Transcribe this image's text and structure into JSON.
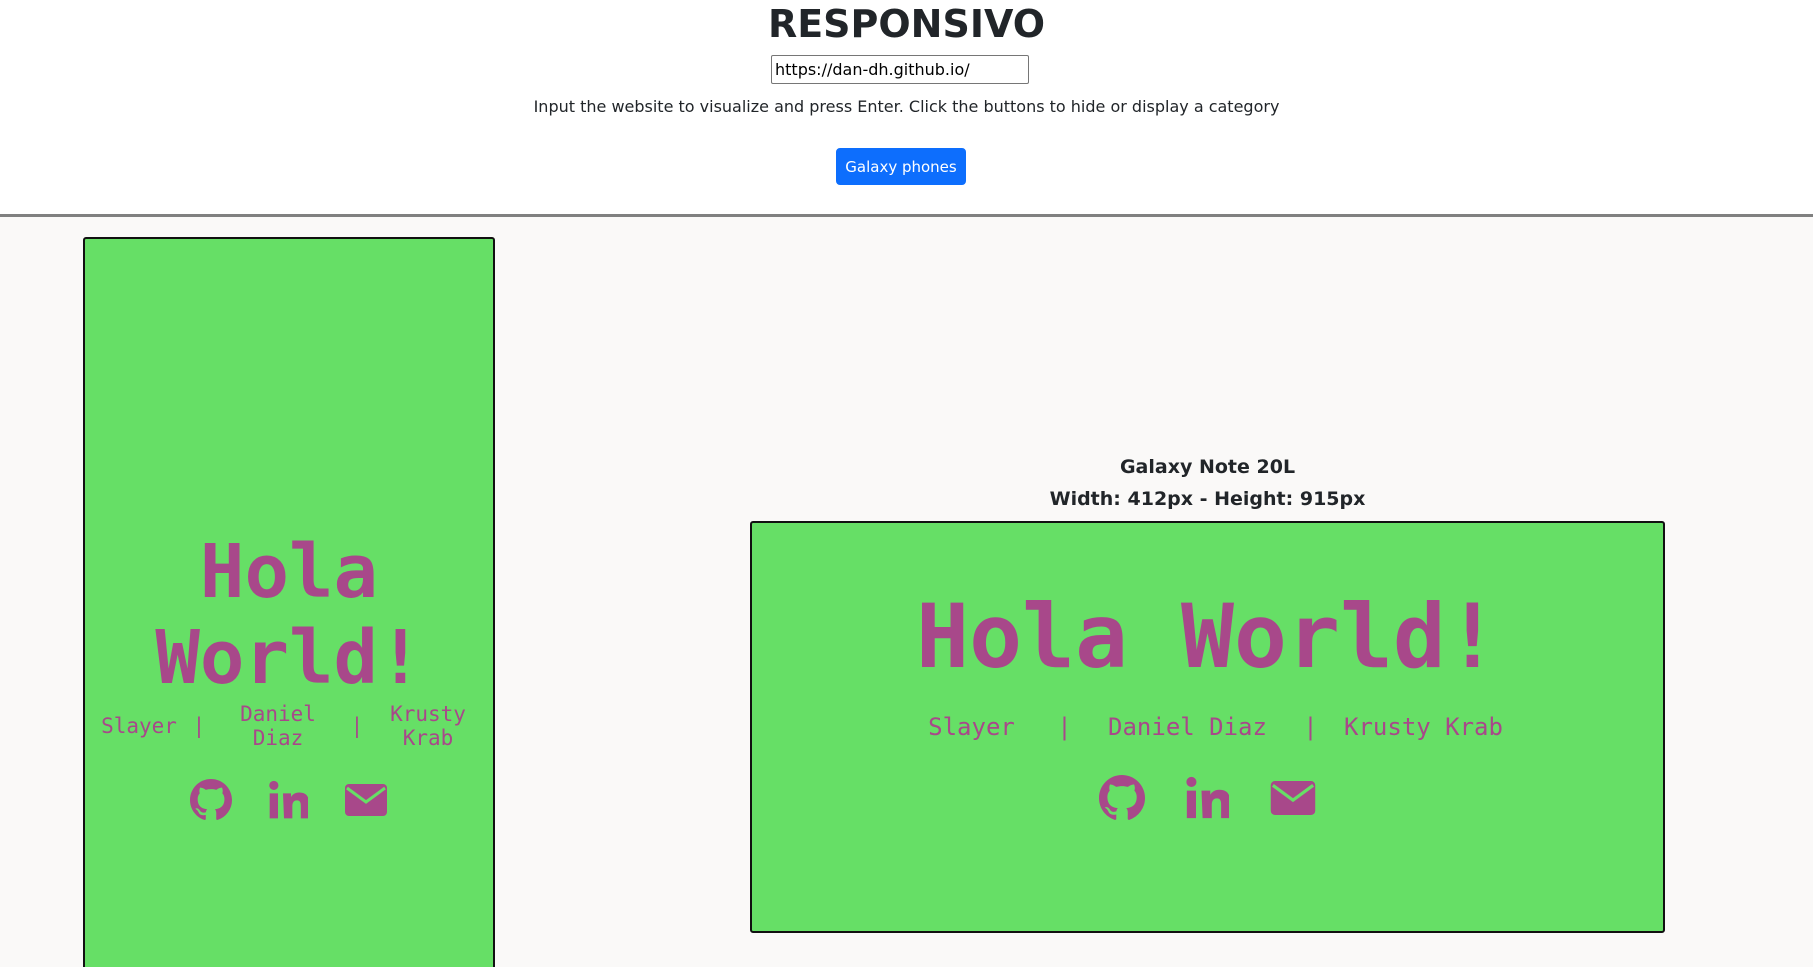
{
  "header": {
    "title": "RESPONSIVO",
    "url_value": "https://dan-dh.github.io/",
    "instructions": "Input the website to visualize and press Enter. Click the buttons to hide or display a category",
    "category_button": "Galaxy phones"
  },
  "colors": {
    "accent": "#0d6efd",
    "site_background": "#66df66",
    "site_text": "#a8488a",
    "area_background": "#faf9f8"
  },
  "site": {
    "hero_line1": "Hola",
    "hero_line2": "World!",
    "hero_full": "Hola World!",
    "link1": "Slayer",
    "link2": "Daniel Diaz",
    "link2_a": "Daniel",
    "link2_b": "Diaz",
    "link3": "Krusty Krab",
    "link3_a": "Krusty",
    "link3_b": "Krab",
    "separator": "|",
    "icons": [
      "github-icon",
      "linkedin-icon",
      "envelope-icon"
    ]
  },
  "devices": [
    {
      "name": "",
      "size": ""
    },
    {
      "name": "Galaxy Note 20L",
      "size": "Width: 412px - Height: 915px"
    }
  ]
}
